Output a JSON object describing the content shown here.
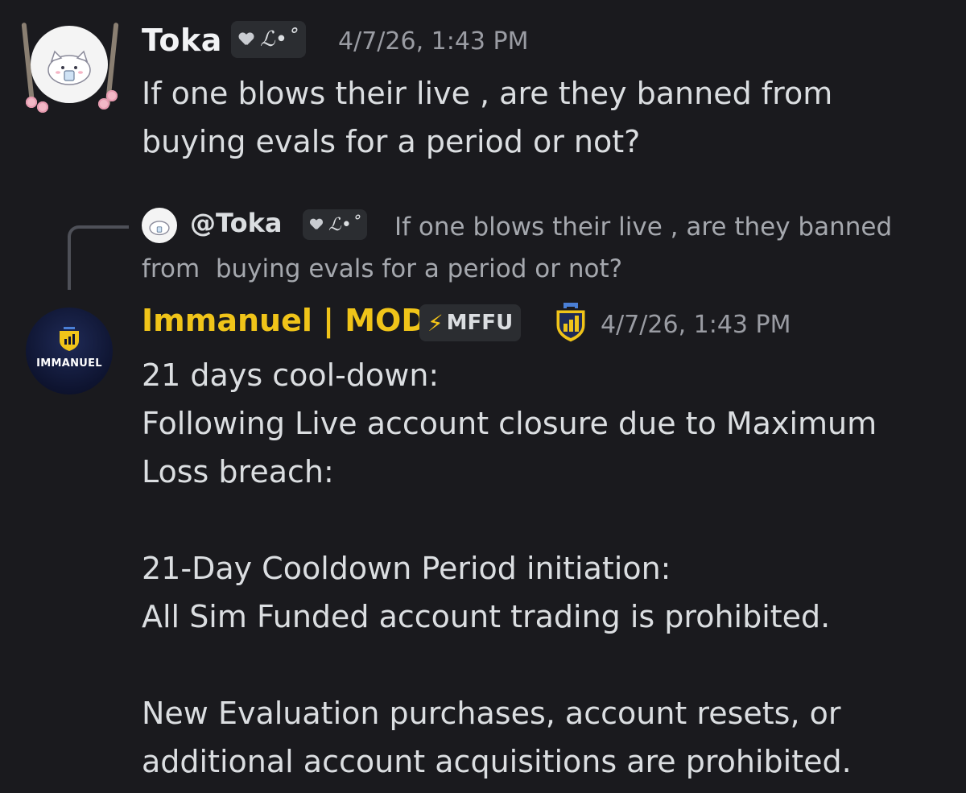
{
  "messages": [
    {
      "username": "Toka",
      "tag": "ℒ•˚",
      "timestamp": "4/7/26, 1:43 PM",
      "text": "If one blows their live , are they banned from buying evals for a period or not?",
      "name_color": "#f2f3f5"
    },
    {
      "reply": {
        "mention": "@Toka",
        "tag": "ℒ•˚",
        "text": "If one blows their live , are they banned from  buying evals for a period or not?"
      },
      "username": "Immanuel | MOD",
      "tag": "MFFU",
      "avatar_label": "IMMANUEL",
      "timestamp": "4/7/26, 1:43 PM",
      "name_color": "#f0c419",
      "lines": [
        "21 days cool-down:",
        "Following Live account closure due to Maximum Loss breach:",
        "",
        "21-Day Cooldown Period initiation:",
        "All Sim Funded account trading is prohibited.",
        "",
        "New Evaluation purchases, account resets, or additional account acquisitions are prohibited."
      ]
    }
  ],
  "icons": {
    "tag_icon": "heart-icon",
    "tag_icon_mffu": "lightning-bolt-icon",
    "mod_badge": "shield-chart-icon"
  },
  "colors": {
    "background": "#1a1a1e",
    "tag_bg": "#2b2d31",
    "text": "#dbdee1",
    "muted": "#9a9ca3",
    "mod_name": "#f0c419"
  }
}
